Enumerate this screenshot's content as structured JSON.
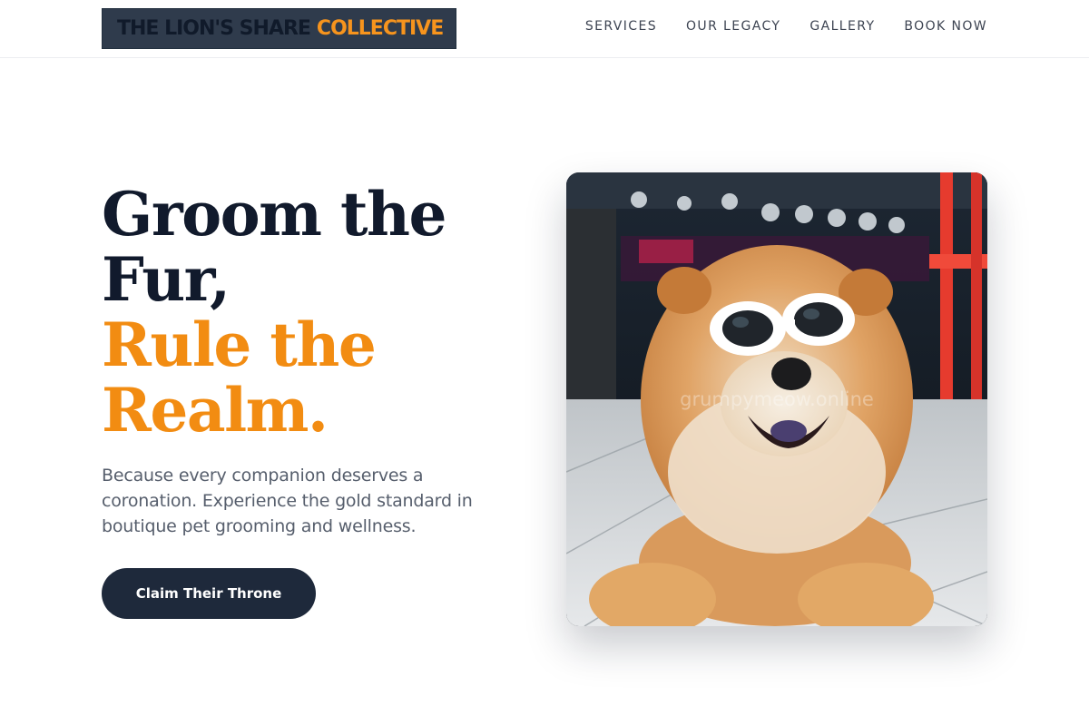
{
  "header": {
    "logo": {
      "part1": "THE LION'S SHARE",
      "part2": "COLLECTIVE"
    },
    "nav": [
      {
        "label": "SERVICES"
      },
      {
        "label": "OUR LEGACY"
      },
      {
        "label": "GALLERY"
      },
      {
        "label": "BOOK NOW"
      }
    ]
  },
  "hero": {
    "headline_lines": [
      "Groom the",
      "Fur,"
    ],
    "accent_lines": [
      "Rule the",
      "Realm."
    ],
    "subtext": "Because every companion deserves a coronation. Experience the gold standard in boutique pet grooming and wellness.",
    "cta_label": "Claim Their Throne"
  },
  "photo": {
    "subject": "chow-chow dog wearing white sunglasses",
    "watermark": "grumpymeow.online"
  },
  "colors": {
    "navy": "#111a2c",
    "accent": "#f28c12",
    "button": "#1e293b",
    "logo_bg": "#2f3b4c"
  }
}
